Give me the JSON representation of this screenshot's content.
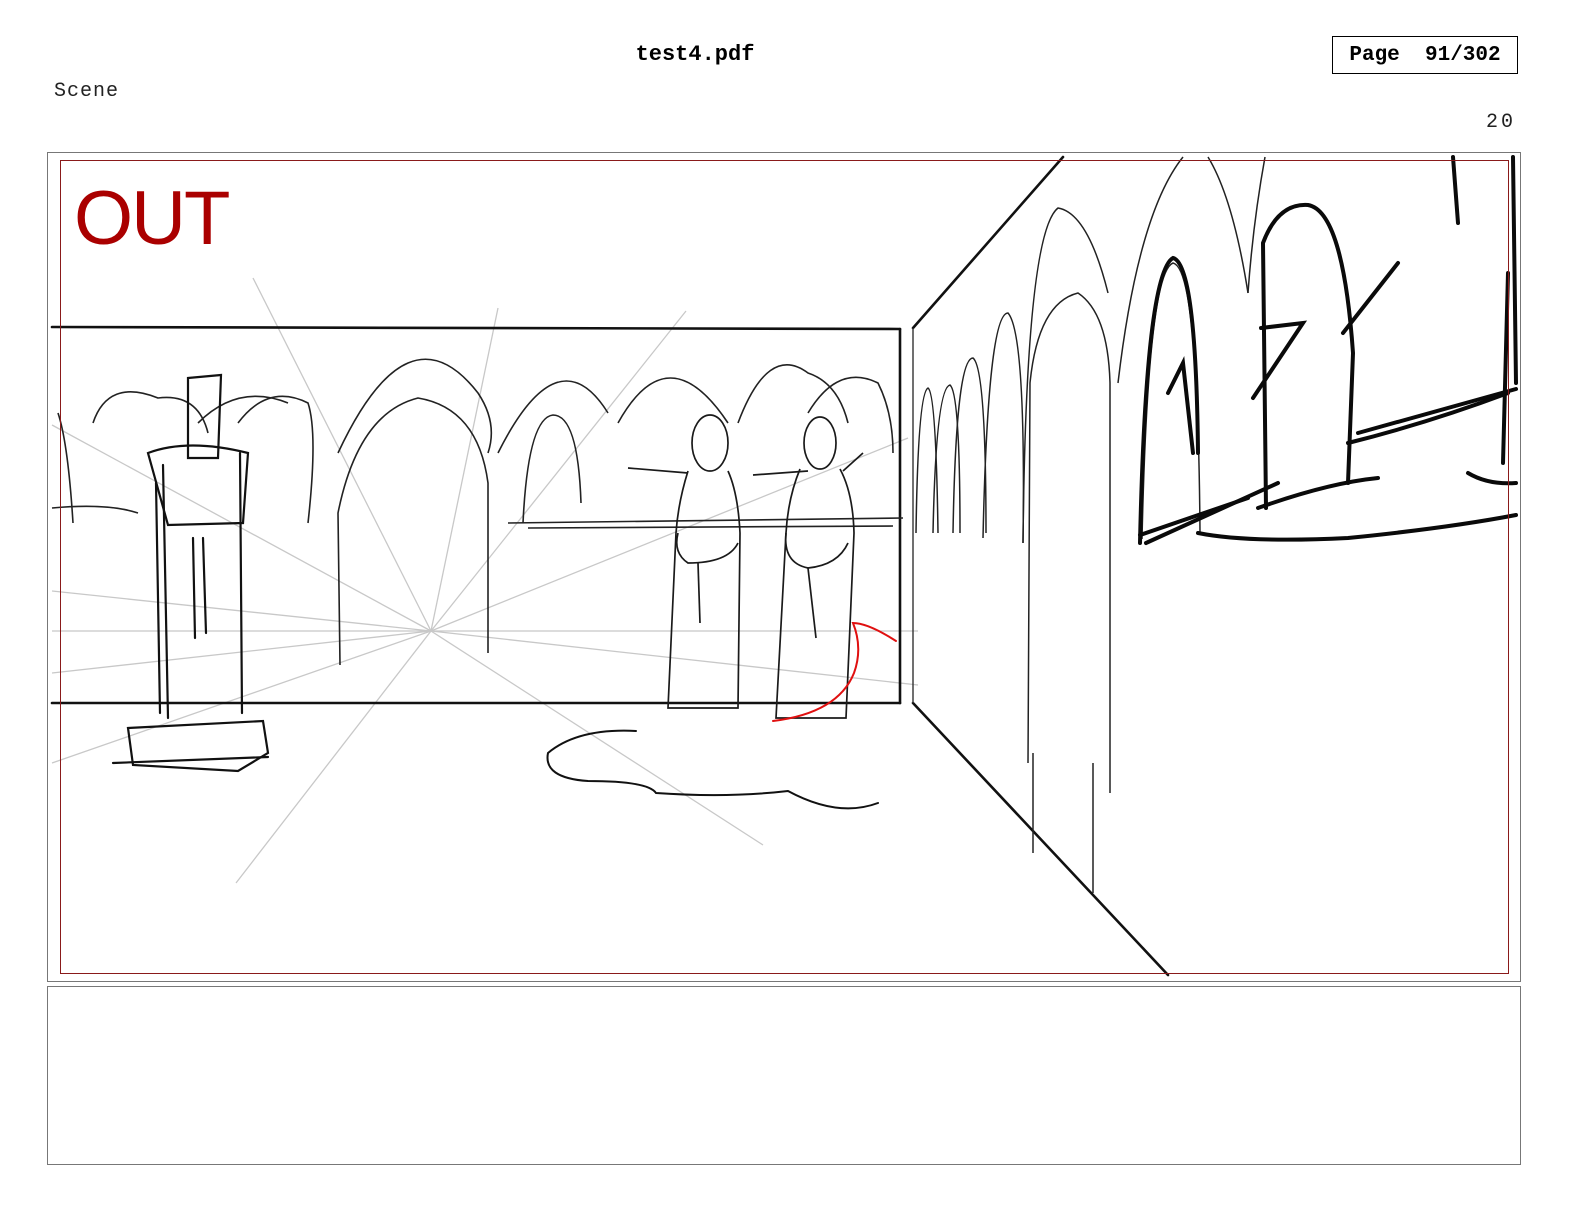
{
  "header": {
    "file_title": "test4.pdf",
    "page_indicator": "Page  91/302"
  },
  "scene": {
    "label": "Scene",
    "panel_number": "20"
  },
  "panel": {
    "stamp_text": "OUT",
    "stamp_color": "#aa0000",
    "safe_frame_color": "#8a1a1a",
    "drawing": "pencil storyboard sketch of an arched cloister with two robed figures"
  },
  "notes": {
    "text": ""
  }
}
